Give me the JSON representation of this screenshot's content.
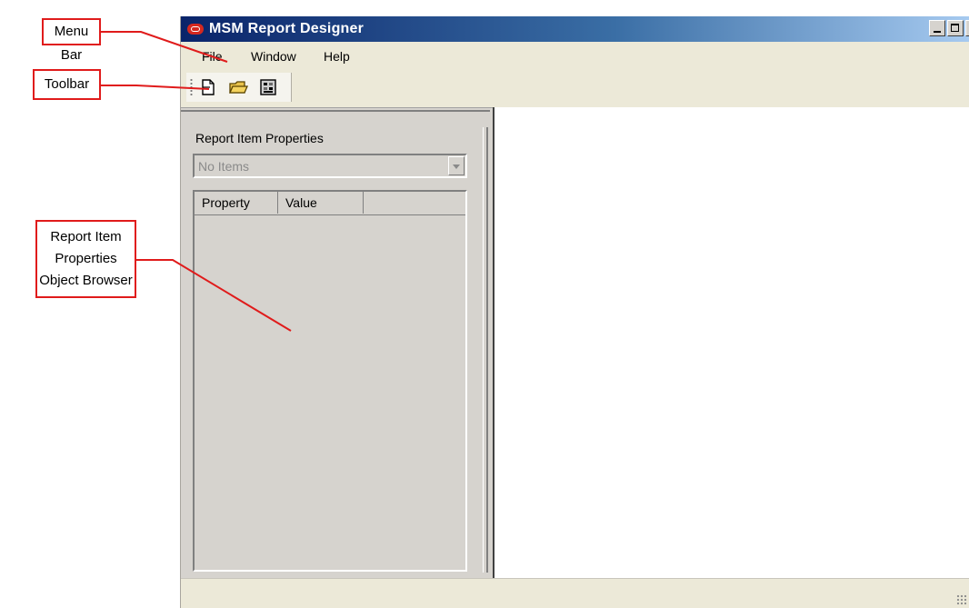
{
  "window": {
    "title": "MSM Report Designer"
  },
  "menubar": {
    "items": [
      "File",
      "Window",
      "Help"
    ]
  },
  "toolbar": {
    "buttons": [
      {
        "icon": "new-document-icon"
      },
      {
        "icon": "open-folder-icon"
      },
      {
        "icon": "properties-icon"
      }
    ]
  },
  "left_panel": {
    "title": "Report Item Properties",
    "combo_value": "No Items",
    "columns": [
      "Property",
      "Value"
    ]
  },
  "annotations": {
    "menu_bar": "Menu Bar",
    "toolbar": "Toolbar",
    "object_browser": [
      "Report Item",
      "Properties",
      "Object Browser"
    ],
    "color": "#e01b1b"
  }
}
